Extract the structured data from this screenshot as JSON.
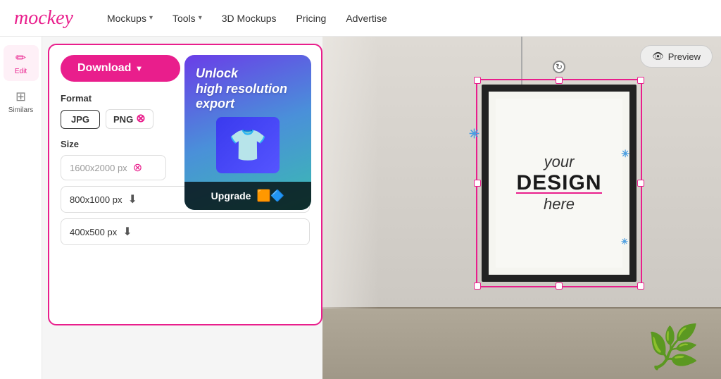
{
  "header": {
    "logo": "mockey",
    "nav": [
      {
        "label": "Mockups",
        "hasChevron": true
      },
      {
        "label": "Tools",
        "hasChevron": true
      },
      {
        "label": "3D Mockups",
        "hasChevron": false
      },
      {
        "label": "Pricing",
        "hasChevron": false
      },
      {
        "label": "Advertise",
        "hasChevron": false
      }
    ]
  },
  "sidebar": {
    "items": [
      {
        "label": "Edit",
        "icon": "✏️",
        "active": true
      },
      {
        "label": "Similars",
        "icon": "⊞",
        "active": false
      }
    ]
  },
  "download_panel": {
    "download_button": "Download",
    "format_label": "Format",
    "jpg_label": "JPG",
    "png_label": "PNG",
    "size_label": "Size",
    "size_hires": "1600x2000 px",
    "size_medium": "800x1000 px",
    "size_small": "400x500 px",
    "upgrade_title": "Unlock\nhigh resolution\nexport",
    "upgrade_button": "Upgrade"
  },
  "canvas": {
    "preview_button": "Preview"
  },
  "frame": {
    "line1": "your",
    "line2": "DESIGN",
    "line3": "here"
  }
}
